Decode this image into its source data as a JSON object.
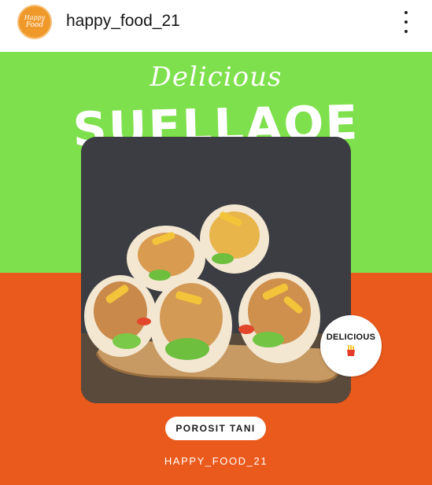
{
  "header": {
    "avatar_line1": "Happy",
    "avatar_line2": "Food",
    "username": "happy_food_21",
    "more_icon": "more-vertical-icon"
  },
  "post": {
    "script_title": "Delicious",
    "main_title": "SUFLLAQE",
    "badge_text": "DELICIOUS",
    "badge_icon": "fries-icon",
    "cta_label": "POROSIT TANI",
    "handle": "HAPPY_FOOD_21",
    "colors": {
      "green": "#7ee04d",
      "orange": "#ea5a1c",
      "avatar": "#f0992b"
    }
  }
}
